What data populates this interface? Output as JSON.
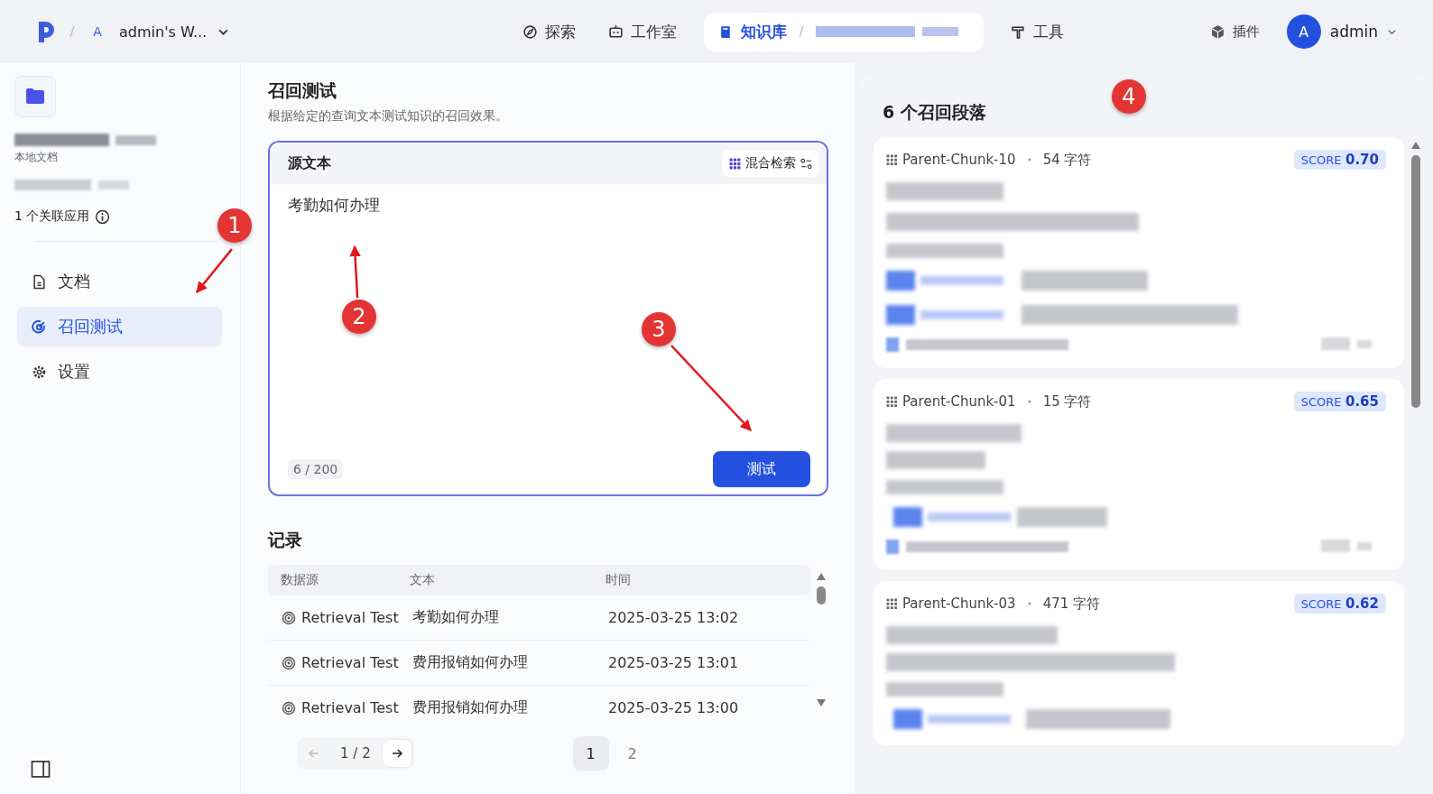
{
  "topbar": {
    "workspace_initial": "A",
    "workspace_name": "admin's W...",
    "nav": [
      {
        "kind": "compass",
        "label": "探索",
        "selected": false
      },
      {
        "kind": "robot",
        "label": "工作室",
        "selected": false
      },
      {
        "kind": "book",
        "label": "知识库",
        "selected": true
      },
      {
        "kind": "tool",
        "label": "工具",
        "selected": false
      }
    ],
    "plugins": "插件",
    "user_initial": "A",
    "user_name": "admin"
  },
  "sidebar": {
    "dataset_type": "本地文档",
    "linked_apps": "1 个关联应用",
    "items": [
      {
        "kind": "doc",
        "label": "文档",
        "selected": false
      },
      {
        "kind": "target",
        "label": "召回测试",
        "selected": true
      },
      {
        "kind": "gear",
        "label": "设置",
        "selected": false
      }
    ]
  },
  "main": {
    "title": "召回测试",
    "description": "根据给定的查询文本测试知识的召回效果。",
    "source_label": "源文本",
    "search_mode": "混合检索",
    "query": "考勤如何办理",
    "counter": "6 / 200",
    "test_button": "测试"
  },
  "records": {
    "title": "记录",
    "columns": [
      "数据源",
      "文本",
      "时间"
    ],
    "rows": [
      {
        "source": "Retrieval Test",
        "text": "考勤如何办理",
        "time": "2025-03-25 13:02"
      },
      {
        "source": "Retrieval Test",
        "text": "费用报销如何办理",
        "time": "2025-03-25 13:01"
      },
      {
        "source": "Retrieval Test",
        "text": "费用报销如何办理",
        "time": "2025-03-25 13:00"
      }
    ],
    "page_indicator": "1 / 2",
    "pages": [
      {
        "label": "1",
        "selected": true
      },
      {
        "label": "2",
        "selected": false
      }
    ]
  },
  "results": {
    "title": "6 个召回段落",
    "chunks": [
      {
        "name": "Parent-Chunk-10",
        "chars": "54 字符",
        "score_label": "SCORE",
        "score": "0.70"
      },
      {
        "name": "Parent-Chunk-01",
        "chars": "15 字符",
        "score_label": "SCORE",
        "score": "0.65"
      },
      {
        "name": "Parent-Chunk-03",
        "chars": "471 字符",
        "score_label": "SCORE",
        "score": "0.62"
      }
    ]
  },
  "annotations": [
    {
      "label": "1"
    },
    {
      "label": "2"
    },
    {
      "label": "3"
    },
    {
      "label": "4"
    }
  ]
}
